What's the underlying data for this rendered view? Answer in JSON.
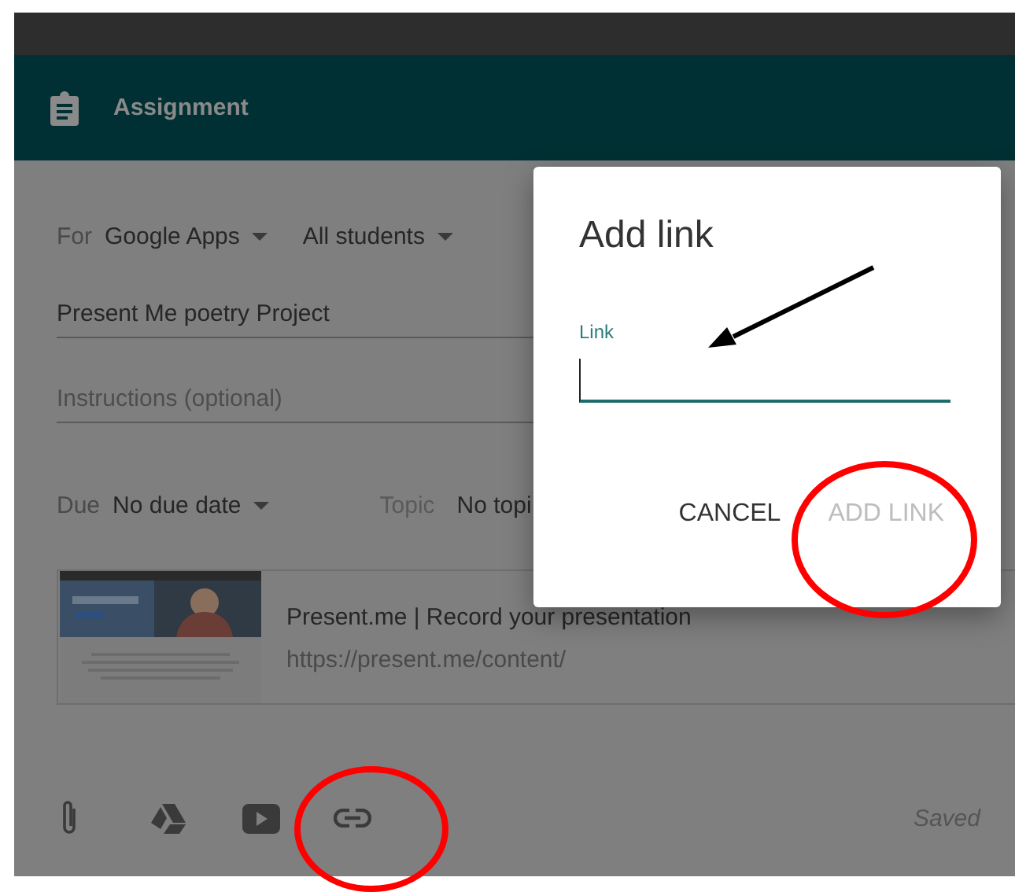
{
  "header": {
    "title": "Assignment"
  },
  "audience": {
    "label": "For",
    "class_name": "Google Apps",
    "students": "All students"
  },
  "title_field": {
    "value": "Present Me poetry Project"
  },
  "instructions_field": {
    "placeholder": "Instructions (optional)"
  },
  "due": {
    "label": "Due",
    "value": "No due date"
  },
  "topic": {
    "label": "Topic",
    "value": "No topi"
  },
  "attachment": {
    "kind": "picture",
    "title": "Present.me | Record your presentation",
    "url": "https://present.me/content/"
  },
  "toolbar": [
    {
      "kind": "file"
    },
    {
      "kind": "drive"
    },
    {
      "kind": "youtube"
    },
    {
      "kind": "link"
    }
  ],
  "status": "Saved",
  "dialog": {
    "title": "Add link",
    "field_label": "Link",
    "field_focused": true,
    "buttons": [
      {
        "label": "CANCEL",
        "disabled": false
      },
      {
        "label": "ADD LINK",
        "disabled": true
      }
    ]
  }
}
